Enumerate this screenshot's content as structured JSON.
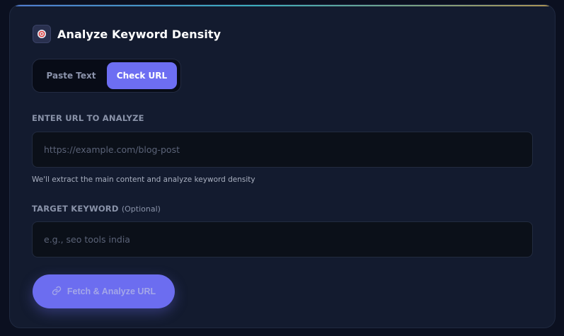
{
  "header": {
    "title": "Analyze Keyword Density",
    "icon": "target-icon"
  },
  "tabs": {
    "paste_text": "Paste Text",
    "check_url": "Check URL",
    "active": "check_url"
  },
  "url_field": {
    "label": "ENTER URL TO ANALYZE",
    "placeholder": "https://example.com/blog-post",
    "value": "",
    "hint": "We'll extract the main content and analyze keyword density"
  },
  "keyword_field": {
    "label": "TARGET KEYWORD",
    "optional": "(Optional)",
    "placeholder": "e.g., seo tools india",
    "value": ""
  },
  "submit": {
    "label": "Fetch & Analyze URL",
    "icon": "link-icon"
  },
  "colors": {
    "accent": "#6d6ef2",
    "card_bg": "#131b2f",
    "page_bg": "#0b1020"
  }
}
